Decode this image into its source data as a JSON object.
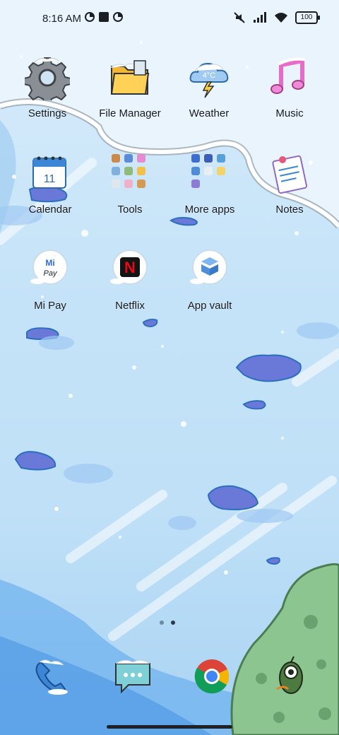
{
  "status_bar": {
    "time": "8:16 AM",
    "battery": "100",
    "icons": [
      "data-saver-icon",
      "square-icon",
      "data-saver-icon",
      "mute-icon",
      "signal-icon",
      "wifi-icon",
      "battery-icon"
    ]
  },
  "apps": {
    "row1": [
      {
        "label": "Settings",
        "icon": "gear-icon"
      },
      {
        "label": "File Manager",
        "icon": "folder-icon"
      },
      {
        "label": "Weather",
        "icon": "cloud-icon",
        "temp": "4°C"
      },
      {
        "label": "Music",
        "icon": "music-note-icon"
      }
    ],
    "row2": [
      {
        "label": "Calendar",
        "icon": "calendar-icon",
        "day": "11"
      },
      {
        "label": "Tools",
        "icon": "folder-grid-icon"
      },
      {
        "label": "More apps",
        "icon": "folder-grid-icon"
      },
      {
        "label": "Notes",
        "icon": "notes-icon"
      }
    ],
    "row3": [
      {
        "label": "Mi Pay",
        "icon": "mi-pay-icon",
        "brand_top": "Mi",
        "brand_bottom": "Pay"
      },
      {
        "label": "Netflix",
        "icon": "netflix-icon",
        "brand": "N"
      },
      {
        "label": "App vault",
        "icon": "app-vault-icon"
      }
    ]
  },
  "dock": [
    {
      "name": "phone",
      "icon": "phone-icon"
    },
    {
      "name": "messages",
      "icon": "chat-icon"
    },
    {
      "name": "chrome",
      "icon": "chrome-icon"
    },
    {
      "name": "camera",
      "icon": "camera-icon"
    }
  ],
  "page_indicator": {
    "count": 2,
    "active": 1
  },
  "colors": {
    "snow": "#ffffff",
    "sky": "#c5e3f8",
    "ice": "#3f8ee0",
    "puddle": "#6d78d6",
    "grass": "#7dbb7e"
  }
}
